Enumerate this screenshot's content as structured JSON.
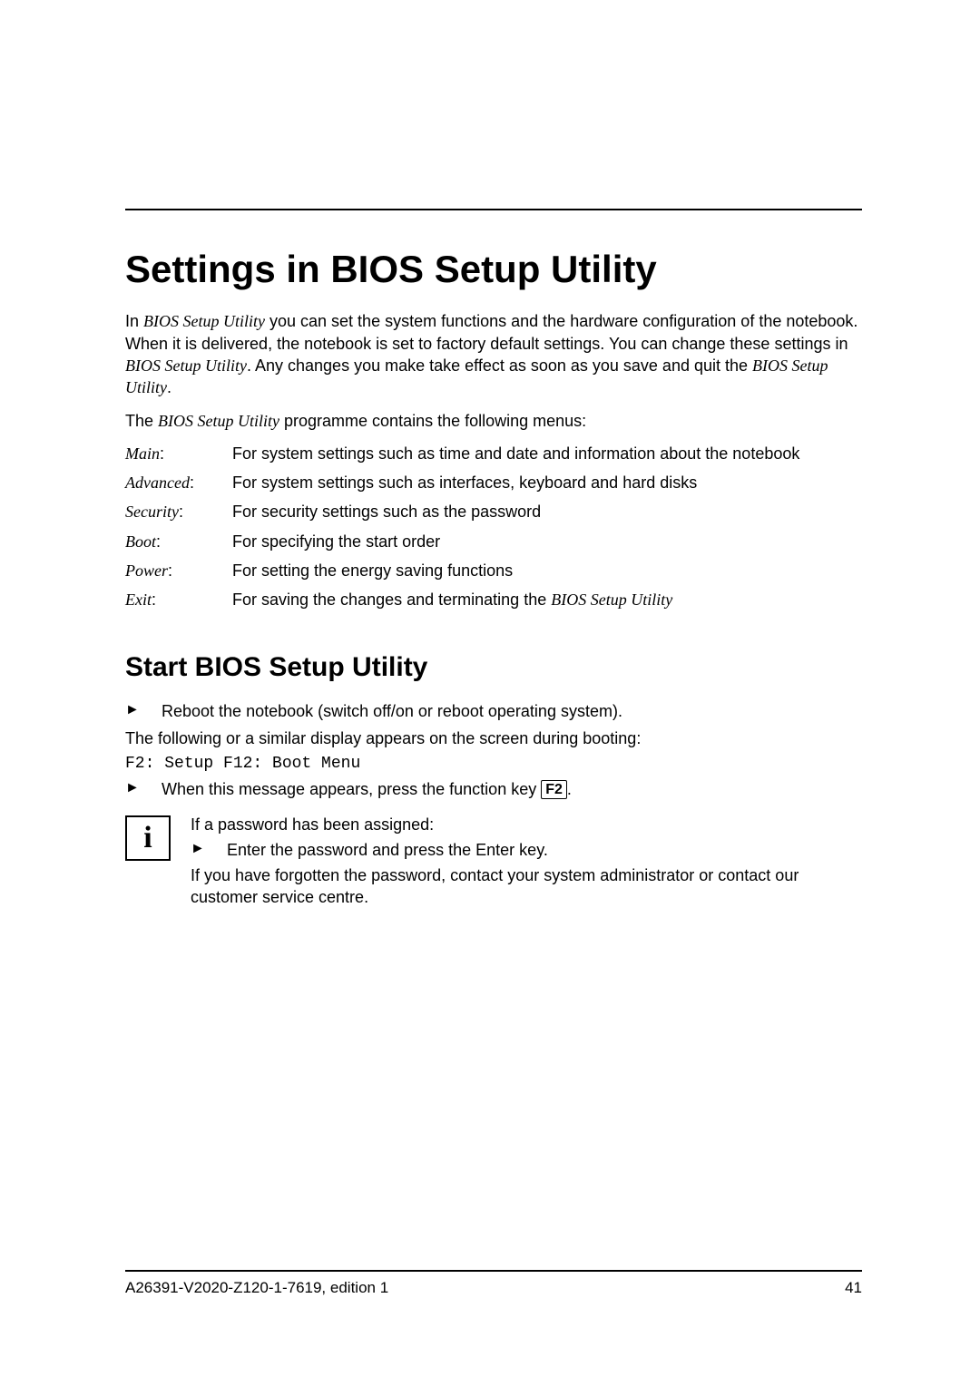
{
  "title": "Settings in BIOS Setup Utility",
  "intro": {
    "prefix1": "In ",
    "bios_em1": "BIOS Setup Utility",
    "after1": " you can set the system functions and the hardware configuration of the notebook.",
    "line2a": "When it is delivered, the notebook is set to factory default settings. You can change these settings in ",
    "bios_em2": "BIOS Setup Utility",
    "line2b": ". Any changes you make take effect as soon as you save and quit the ",
    "bios_em3": "BIOS Setup Utility",
    "line2c": "."
  },
  "menus_intro_prefix": "The ",
  "menus_intro_em": "BIOS Setup Utility",
  "menus_intro_suffix": " programme contains the following menus:",
  "menus": [
    {
      "label_name": "Main",
      "colon": ":",
      "desc": "For system settings such as time and date and information about the notebook"
    },
    {
      "label_name": "Advanced",
      "colon": ":",
      "desc": "For system settings such as interfaces, keyboard and hard disks"
    },
    {
      "label_name": "Security",
      "colon": ":",
      "desc": "For security settings such as the password"
    },
    {
      "label_name": "Boot",
      "colon": ":",
      "desc": "For specifying the start order"
    },
    {
      "label_name": "Power",
      "colon": ":",
      "desc": "For setting the energy saving functions"
    },
    {
      "label_name": "Exit",
      "colon": ":",
      "desc_prefix": "For saving the changes and terminating the ",
      "desc_em": "BIOS Setup Utility"
    }
  ],
  "subtitle": "Start BIOS Setup Utility",
  "steps1": [
    "Reboot the notebook (switch off/on or reboot operating system)."
  ],
  "after_step1": "The following or a similar display appears on the screen during booting:",
  "mono_line": "F2: Setup   F12: Boot Menu",
  "step2_prefix": "When this message appears, press the function key ",
  "step2_key": "F2",
  "step2_suffix": ".",
  "info": {
    "icon": "i",
    "line1": "If a password has been assigned:",
    "bullet": "Enter the password and press the Enter key.",
    "line2": "If you have forgotten the password, contact your system administrator or contact our customer service centre."
  },
  "footer": {
    "left": "A26391-V2020-Z120-1-7619, edition 1",
    "right": "41"
  }
}
